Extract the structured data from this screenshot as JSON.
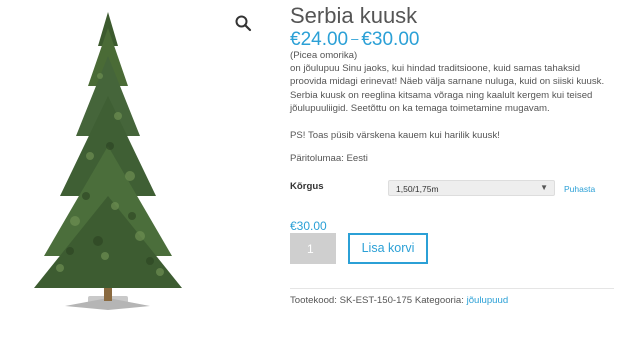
{
  "product": {
    "title": "Serbia kuusk",
    "price_min": "€24.00",
    "price_separator": "–",
    "price_max": "€30.00",
    "latin_name": "(Picea omorika)",
    "description": "on jõulupuu Sinu jaoks, kui hindad traditsioone, kuid samas tahaksid proovida midagi erinevat! Näeb välja sarnane nuluga, kuid on siiski kuusk. Serbia kuusk on reeglina kitsama võraga ning kaalult kergem kui teised jõulupuuliigid. Seetõttu on ka temaga toimetamine mugavam.",
    "note": "PS! Toas püsib värskena kauem kui harilik kuusk!",
    "origin": "Päritolumaa: Eesti"
  },
  "variation": {
    "label": "Kõrgus",
    "selected": "1,50/1,75m",
    "reset_label": "Puhasta"
  },
  "cart": {
    "selected_price": "€30.00",
    "quantity": "1",
    "add_label": "Lisa korvi"
  },
  "meta": {
    "sku_label": "Tootekood:",
    "sku": "SK-EST-150-175",
    "category_label": "Kategooria:",
    "category": "jõulupuud"
  },
  "icons": {
    "zoom": "search-icon",
    "dropdown": "chevron-down-icon"
  },
  "colors": {
    "accent": "#2ba0d6",
    "text": "#555555",
    "qty_bg": "#cfcfcf",
    "select_bg": "#eeeeee"
  }
}
